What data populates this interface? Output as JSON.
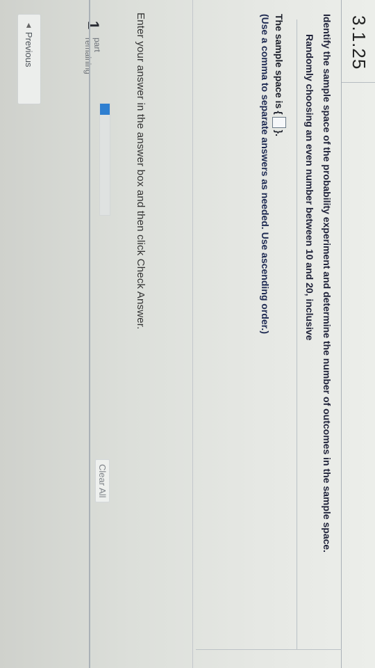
{
  "header": {
    "question_id": "3.1.25"
  },
  "question": {
    "prompt": "Identify the sample space of the probability experiment and determine the number of outcomes in the sample space.",
    "experiment": "Randomly choosing an even number between 10 and 20, inclusive",
    "answer_prefix": "The sample space is",
    "answer_brace_open": "{",
    "answer_value": "",
    "answer_brace_close": "}.",
    "hint": "(Use a comma to separate answers as needed. Use ascending order.)"
  },
  "instruction": "Enter your answer in the answer box and then click Check Answer.",
  "actions": {
    "clear_all": "Clear All",
    "previous": "Previous"
  },
  "progress": {
    "count": "1",
    "label_line1": "part",
    "label_line2": "remaining",
    "fraction": 0.1
  },
  "colors": {
    "progress_fill": "#2f7fd0"
  },
  "icons": {
    "previous": "triangle-left-icon"
  }
}
